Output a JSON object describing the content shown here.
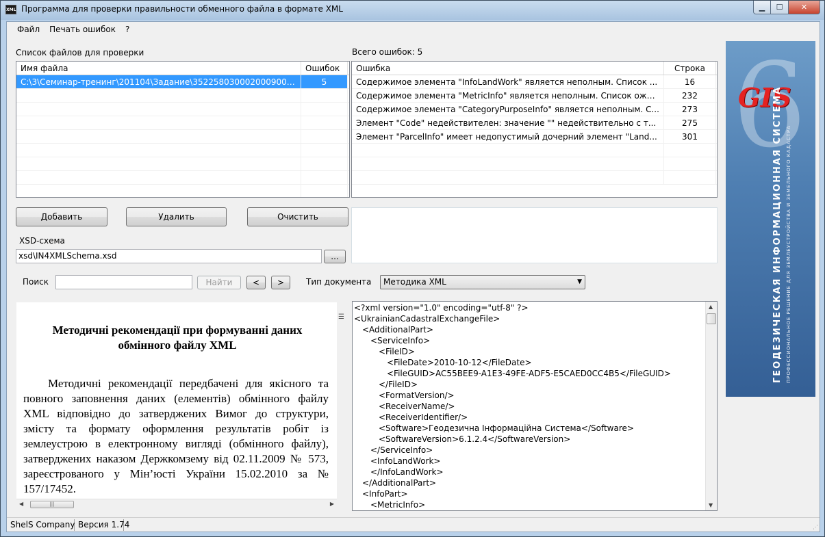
{
  "window": {
    "title": "Программа для проверки правильности  обменного файла в формате XML",
    "icon_text": "XML",
    "buttons": {
      "minimize": "▁",
      "maximize": "☐",
      "close": "✕"
    }
  },
  "menu": [
    "Файл",
    "Печать ошибок",
    "?"
  ],
  "files_panel": {
    "label": "Список файлов для проверки",
    "columns": [
      "Имя файла",
      "Ошибок"
    ],
    "rows": [
      {
        "name": "C:\\3\\Семинар-тренинг\\201104\\Задание\\3522580300020009006.x...",
        "errors": "5"
      }
    ]
  },
  "errors_panel": {
    "label": "Всего ошибок: 5",
    "columns": [
      "Ошибка",
      "Строка"
    ],
    "rows": [
      {
        "message": "Содержимое элемента \"InfoLandWork\" является неполным. Список ...",
        "line": "16"
      },
      {
        "message": "Содержимое элемента \"MetricInfo\" является неполным. Список ожи...",
        "line": "232"
      },
      {
        "message": "Содержимое элемента \"CategoryPurposeInfo\" является неполным. С...",
        "line": "273"
      },
      {
        "message": "Элемент \"Code\" недействителен: значение \"\" недействительно с т...",
        "line": "275"
      },
      {
        "message": "Элемент \"ParcelInfo\" имеет недопустимый дочерний элемент \"Land...",
        "line": "301"
      }
    ]
  },
  "buttons": {
    "add": "Добавить",
    "remove": "Удалить",
    "clear": "Очистить",
    "browse": "...",
    "find": "Найти",
    "prev": "<",
    "next": ">"
  },
  "xsd": {
    "label": "XSD-схема",
    "value": "xsd\\IN4XMLSchema.xsd"
  },
  "search": {
    "label": "Поиск",
    "value": ""
  },
  "doc_type": {
    "label": "Тип документа",
    "selected": "Методика XML"
  },
  "document": {
    "title": "Методичні рекомендації при формуванні даних обмінного файлу XML",
    "body": "Методичні рекомендації передбачені для якісного та повного заповнення даних (елементів) обмінного файлу XML відповідно до затверджених Вимог до структури, змісту та формату оформлення результатів робіт із землеустрою в електронному вигляді (обмінного файлу), затверджених наказом Держкомзему від 02.11.2009 № 573, зареєстрованого у Мін’юсті України 15.02.2010 за           № 157/17452."
  },
  "xml_lines": [
    {
      "indent": 0,
      "text": "<?xml version=\"1.0\" encoding=\"utf-8\" ?>"
    },
    {
      "indent": 0,
      "text": "<UkrainianCadastralExchangeFile>"
    },
    {
      "indent": 1,
      "text": "<AdditionalPart>"
    },
    {
      "indent": 2,
      "text": "<ServiceInfo>"
    },
    {
      "indent": 3,
      "text": "<FileID>"
    },
    {
      "indent": 4,
      "text": "<FileDate>2010-10-12</FileDate>"
    },
    {
      "indent": 4,
      "text": "<FileGUID>AC55BEE9-A1E3-49FE-ADF5-E5CAED0CC4B5</FileGUID>"
    },
    {
      "indent": 3,
      "text": "</FileID>"
    },
    {
      "indent": 3,
      "text": "<FormatVersion/>"
    },
    {
      "indent": 3,
      "text": "<ReceiverName/>"
    },
    {
      "indent": 3,
      "text": "<ReceiverIdentifier/>"
    },
    {
      "indent": 3,
      "text": "<Software>Геодезична Інформаційна Система</Software>"
    },
    {
      "indent": 3,
      "text": "<SoftwareVersion>6.1.2.4</SoftwareVersion>"
    },
    {
      "indent": 2,
      "text": "</ServiceInfo>"
    },
    {
      "indent": 2,
      "text": "<InfoLandWork>"
    },
    {
      "indent": 2,
      "text": "</InfoLandWork>"
    },
    {
      "indent": 1,
      "text": "</AdditionalPart>"
    },
    {
      "indent": 1,
      "text": "<InfoPart>"
    },
    {
      "indent": 2,
      "text": "<MetricInfo>"
    }
  ],
  "logo": {
    "brand": "GIS",
    "digit": "6",
    "tagline": "ГЕОДЕЗИЧЕСКАЯ ИНФОРМАЦИОННАЯ СИСТЕМА",
    "subtagline": "ПРОФЕССИОНАЛЬНОЕ РЕШЕНИЕ ДЛЯ ЗЕМЛЕУСТРОЙСТВА И ЗЕМЕЛЬНОГО КАДАСТРА"
  },
  "status": {
    "company": "ShelS Company",
    "version": "Версия 1.74"
  }
}
